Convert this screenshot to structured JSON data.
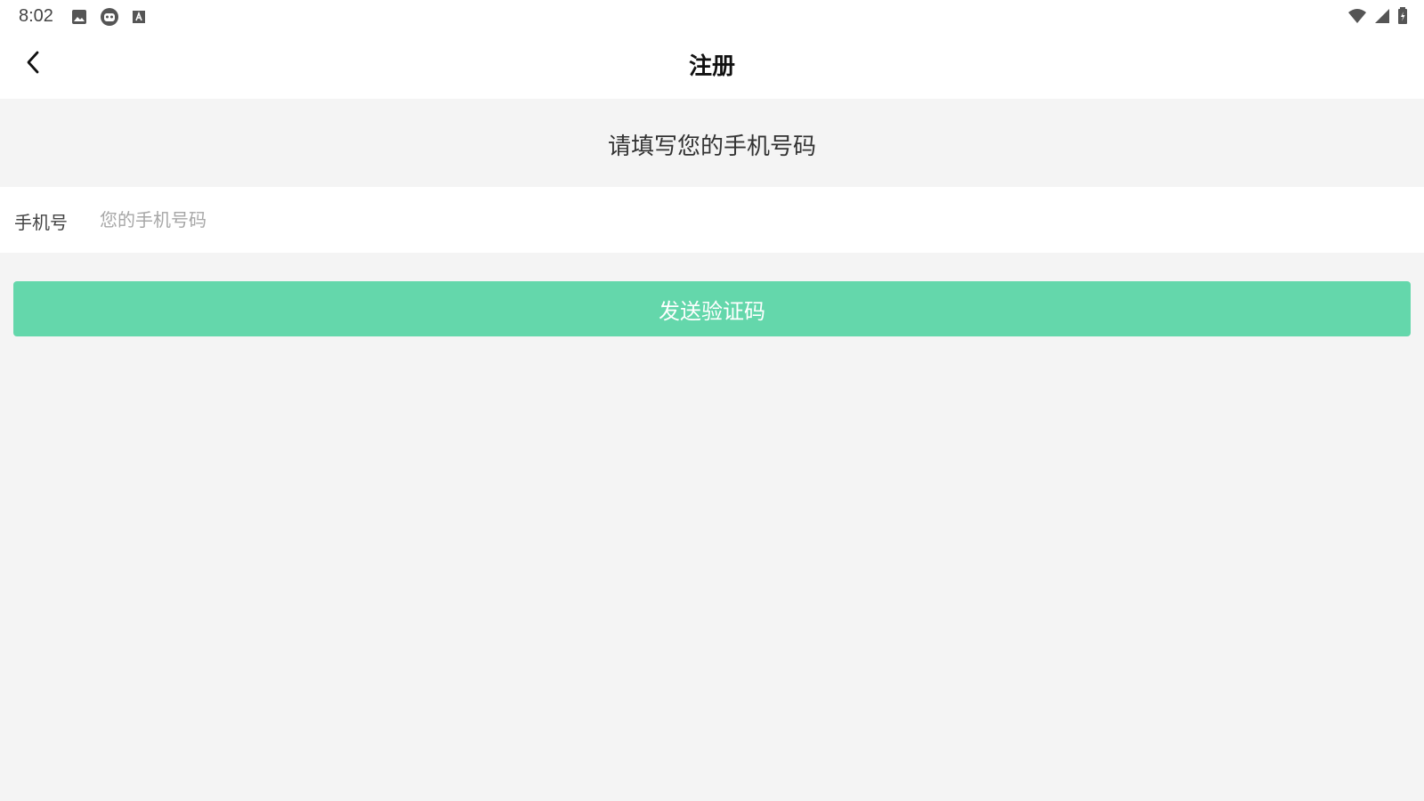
{
  "status_bar": {
    "time": "8:02",
    "left_icons": [
      "image-icon",
      "robot-icon",
      "text-a-icon"
    ],
    "right_icons": [
      "wifi-icon",
      "signal-icon",
      "battery-icon"
    ]
  },
  "header": {
    "back_icon": "chevron-left-icon",
    "title": "注册"
  },
  "prompt": "请填写您的手机号码",
  "phone_field": {
    "label": "手机号",
    "value": "",
    "placeholder": "您的手机号码"
  },
  "send_button": {
    "label": "发送验证码",
    "color": "#64d7ab"
  }
}
